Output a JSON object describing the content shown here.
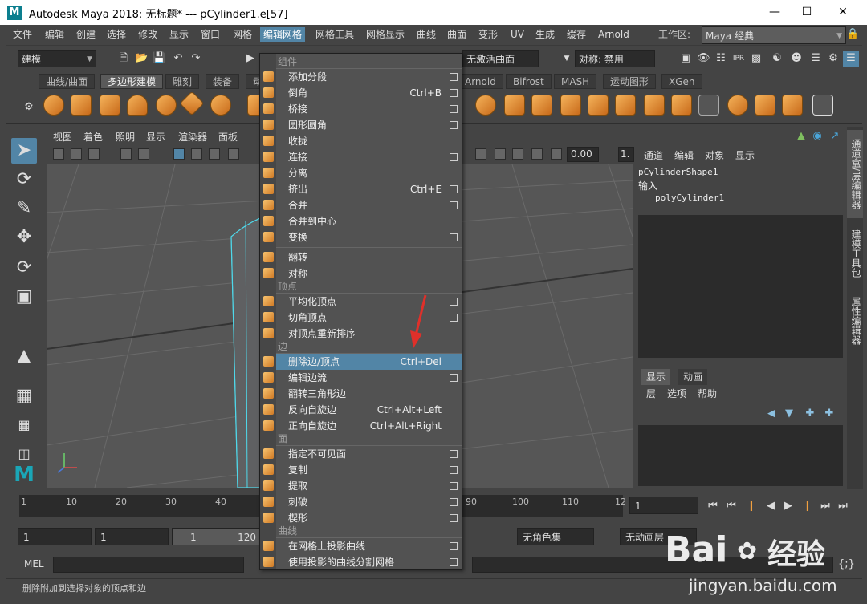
{
  "window": {
    "title": "Autodesk Maya 2018: 无标题*   ---   pCylinder1.e[57]",
    "logo": "M",
    "controls": [
      "minimize-icon",
      "maximize-icon",
      "close-icon"
    ]
  },
  "menubar": {
    "items": [
      "文件",
      "编辑",
      "创建",
      "选择",
      "修改",
      "显示",
      "窗口",
      "网格",
      "编辑网格",
      "网格工具",
      "网格显示",
      "曲线",
      "曲面",
      "变形",
      "UV",
      "生成",
      "缓存",
      "Arnold"
    ],
    "active": "编辑网格",
    "workspace_label": "工作区:",
    "workspace_value": "Maya 经典"
  },
  "toolbar": {
    "mode": "建模",
    "no_active_surface": "无激活曲面",
    "symmetry": "对称: 禁用"
  },
  "shelf": {
    "tabs": [
      "曲线/曲面",
      "多边形建模",
      "雕刻",
      "装备",
      "动",
      "Arnold",
      "Bifrost",
      "MASH",
      "运动图形",
      "XGen"
    ],
    "active_tab": "多边形建模"
  },
  "viewport": {
    "menus": [
      "视图",
      "着色",
      "照明",
      "显示",
      "渲染器",
      "面板"
    ],
    "field_value": "0.00",
    "field_value2": "1."
  },
  "channel_box": {
    "menus": [
      "通道",
      "编辑",
      "对象",
      "显示"
    ],
    "shape": "pCylinderShape1",
    "inputs_label": "输入",
    "input_node": "polyCylinder1"
  },
  "side_tabs": [
    "通道盒/层编辑器",
    "建模工具包",
    "属性编辑器"
  ],
  "layer_editor": {
    "tabs": [
      "显示",
      "动画"
    ],
    "menus": [
      "层",
      "选项",
      "帮助"
    ]
  },
  "timeline": {
    "ticks": [
      "1",
      "10",
      "20",
      "30",
      "40",
      "90",
      "100",
      "110",
      "12"
    ],
    "current_frame": "1"
  },
  "range": {
    "start": "1",
    "start2": "1",
    "inner_start": "1",
    "inner_end": "120",
    "charset": "无角色集",
    "anim_layer": "无动画层"
  },
  "command": {
    "label": "MEL"
  },
  "status": {
    "text": "删除附加到选择对象的顶点和边"
  },
  "dropdown": {
    "sections": {
      "components": "组件",
      "vertex": "顶点",
      "edge": "边",
      "face": "面",
      "curve": "曲线"
    },
    "items": [
      {
        "label": "添加分段",
        "shortcut": "",
        "box": true
      },
      {
        "label": "倒角",
        "shortcut": "Ctrl+B",
        "box": true
      },
      {
        "label": "桥接",
        "shortcut": "",
        "box": true
      },
      {
        "label": "圆形圆角",
        "shortcut": "",
        "box": true
      },
      {
        "label": "收拢",
        "shortcut": "",
        "box": false
      },
      {
        "label": "连接",
        "shortcut": "",
        "box": true
      },
      {
        "label": "分离",
        "shortcut": "",
        "box": false
      },
      {
        "label": "挤出",
        "shortcut": "Ctrl+E",
        "box": true
      },
      {
        "label": "合并",
        "shortcut": "",
        "box": true
      },
      {
        "label": "合并到中心",
        "shortcut": "",
        "box": false
      },
      {
        "label": "变换",
        "shortcut": "",
        "box": true
      },
      {
        "label": "翻转",
        "shortcut": "",
        "box": false
      },
      {
        "label": "对称",
        "shortcut": "",
        "box": false
      },
      {
        "label": "平均化顶点",
        "shortcut": "",
        "box": true
      },
      {
        "label": "切角顶点",
        "shortcut": "",
        "box": true
      },
      {
        "label": "对顶点重新排序",
        "shortcut": "",
        "box": false
      },
      {
        "label": "删除边/顶点",
        "shortcut": "Ctrl+Del",
        "box": false
      },
      {
        "label": "编辑边流",
        "shortcut": "",
        "box": true
      },
      {
        "label": "翻转三角形边",
        "shortcut": "",
        "box": false
      },
      {
        "label": "反向自旋边",
        "shortcut": "Ctrl+Alt+Left",
        "box": false
      },
      {
        "label": "正向自旋边",
        "shortcut": "Ctrl+Alt+Right",
        "box": false
      },
      {
        "label": "指定不可见面",
        "shortcut": "",
        "box": true
      },
      {
        "label": "复制",
        "shortcut": "",
        "box": true
      },
      {
        "label": "提取",
        "shortcut": "",
        "box": true
      },
      {
        "label": "刺破",
        "shortcut": "",
        "box": true
      },
      {
        "label": "楔形",
        "shortcut": "",
        "box": true
      },
      {
        "label": "在网格上投影曲线",
        "shortcut": "",
        "box": true
      },
      {
        "label": "使用投影的曲线分割网格",
        "shortcut": "",
        "box": true
      }
    ],
    "highlighted": "删除边/顶点"
  },
  "watermark": {
    "brand": "Bai",
    "brand2": "经验",
    "url": "jingyan.baidu.com"
  }
}
